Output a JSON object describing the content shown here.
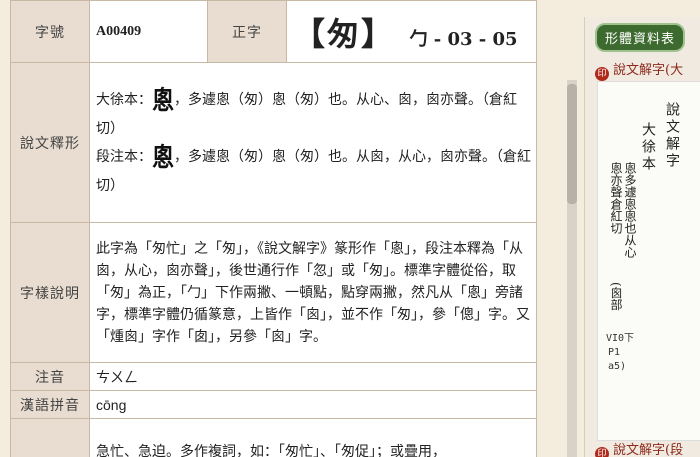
{
  "header": {
    "code_label": "字號",
    "code": "A00409",
    "zhengzi_label": "正字",
    "zhengzi": "【匆】",
    "radical_info": "勹 - 03 - 05"
  },
  "shuowen": {
    "label": "說文釋形",
    "lines": [
      {
        "prefix": "大徐本：",
        "glyph": "悤",
        "text": "，多遽悤（匆）悤（匆）也。从心、囪，囪亦聲。（倉紅切）"
      },
      {
        "prefix": "段注本：",
        "glyph": "悤",
        "text": "，多遽悤（匆）悤（匆）也。从囪，从心，囪亦聲。（倉紅切）"
      }
    ]
  },
  "explanation": {
    "label": "字樣說明",
    "text": "此字為「匆忙」之「匆」，《說文解字》篆形作「悤」，段注本釋為「从囪，从心，囪亦聲」，後世通行作「忽」或「匆」。標準字體從俗，取「匆」為正，「勹」下作兩撇、一頓點，點穿兩撇，然凡从「悤」旁諸字，標準字體仍循篆意，上皆作「囪」，並不作「匆」，參「傯」字。又「煄囪」字作「囱」，另參「囪」字。"
  },
  "zhuyin": {
    "label": "注音",
    "value": "ㄘㄨㄥ"
  },
  "pinyin": {
    "label": "漢語拼音",
    "value": "cōng"
  },
  "definition": {
    "label": "",
    "text": "急忙、急迫。多作複詞，如：「匆忙」、「匆促」；或疊用，"
  },
  "side": {
    "tab": "形體資料表",
    "section1": "說文解字(大",
    "section2": "說文解字(段",
    "book_title_col": "說文解字",
    "book_sub_col": "大徐本",
    "book_glyph_col": "悤多遽悤悤也从心",
    "book_glyph_col2": "悤亦聲倉紅切",
    "book_note": "(囪部",
    "hand_note_1": "VI0下",
    "hand_note_2": "P1",
    "hand_note_3": "a5)"
  },
  "colors": {
    "label_bg": "#e8ddd0",
    "border": "#c8b9a6",
    "page_bg": "#f4ecdc",
    "tab_green": "#3d6b2f",
    "seal_red": "#b02a1c"
  }
}
